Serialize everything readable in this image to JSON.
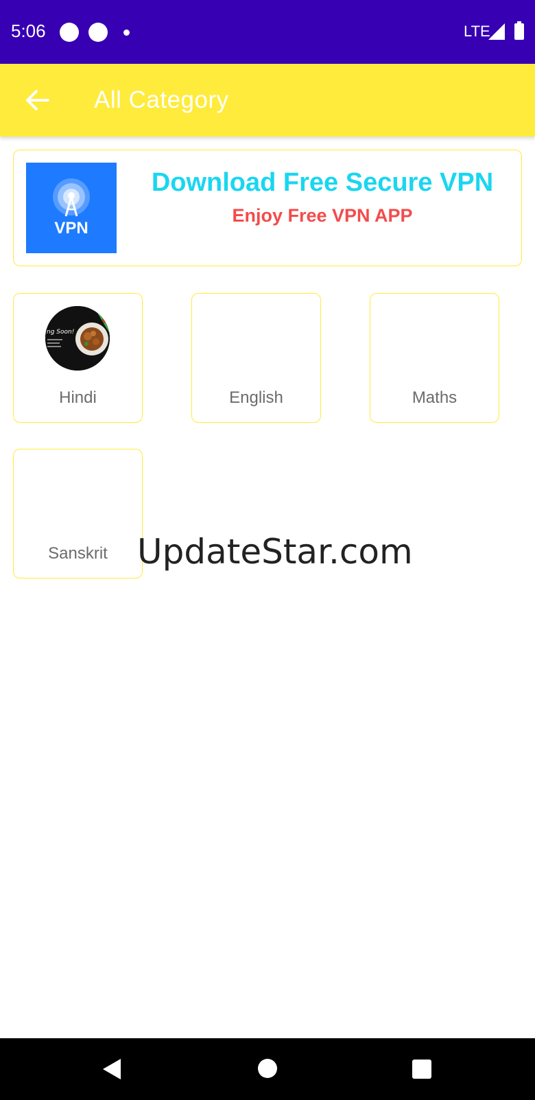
{
  "status_bar": {
    "time": "5:06",
    "network": "LTE",
    "icons": [
      "notification-dot-icon",
      "notification-dot-icon",
      "small-dot-icon",
      "signal-icon",
      "battery-icon"
    ]
  },
  "app_bar": {
    "title": "All Category",
    "back_icon": "arrow-left-icon",
    "background": "#ffeb3b"
  },
  "vpn_banner": {
    "logo_text": "VPN",
    "headline": "Download Free Secure VPN",
    "subline": "Enjoy Free VPN APP",
    "headline_color": "#1ad6f0",
    "subline_color": "#f44b4b",
    "logo_color": "#1e7bff"
  },
  "categories": [
    {
      "label": "Hindi",
      "thumbnail_text": "ng Soon!"
    },
    {
      "label": "English"
    },
    {
      "label": "Maths"
    },
    {
      "label": "Sanskrit"
    }
  ],
  "watermark": "UpdateStar.com",
  "nav_bar": {
    "icons": [
      "nav-back-icon",
      "nav-home-icon",
      "nav-recents-icon"
    ]
  },
  "colors": {
    "status_bar": "#3700b3",
    "card_border": "#ffeb3b"
  }
}
